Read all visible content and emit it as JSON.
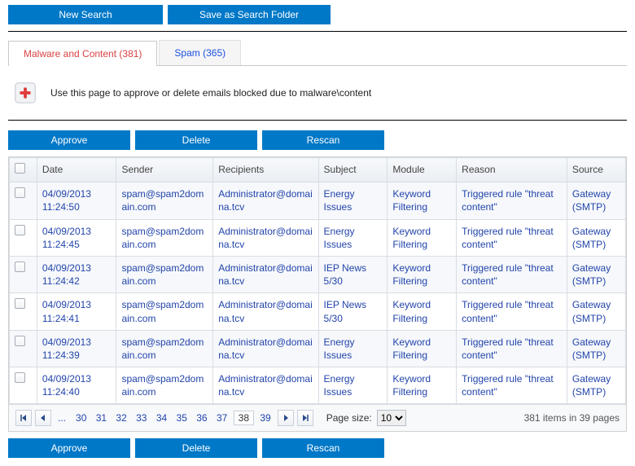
{
  "top_buttons": {
    "new_search": "New Search",
    "save_folder": "Save as Search Folder"
  },
  "tabs": [
    {
      "label": "Malware and Content (381)",
      "active": true
    },
    {
      "label": "Spam (365)",
      "active": false
    }
  ],
  "info_text": "Use this page to approve or delete emails blocked due to malware\\content",
  "actions": {
    "approve": "Approve",
    "delete": "Delete",
    "rescan": "Rescan"
  },
  "columns": {
    "date": "Date",
    "sender": "Sender",
    "recipients": "Recipients",
    "subject": "Subject",
    "module": "Module",
    "reason": "Reason",
    "source": "Source"
  },
  "rows": [
    {
      "date": "04/09/2013 11:24:50",
      "sender": "spam@spam2domain.com",
      "recipients": "Administrator@domaina.tcv",
      "subject": "Energy Issues",
      "module": "Keyword Filtering",
      "reason": "Triggered rule \"threat content\"",
      "source": "Gateway (SMTP)"
    },
    {
      "date": "04/09/2013 11:24:45",
      "sender": "spam@spam2domain.com",
      "recipients": "Administrator@domaina.tcv",
      "subject": "Energy Issues",
      "module": "Keyword Filtering",
      "reason": "Triggered rule \"threat content\"",
      "source": "Gateway (SMTP)"
    },
    {
      "date": "04/09/2013 11:24:42",
      "sender": "spam@spam2domain.com",
      "recipients": "Administrator@domaina.tcv",
      "subject": "IEP News 5/30",
      "module": "Keyword Filtering",
      "reason": "Triggered rule \"threat content\"",
      "source": "Gateway (SMTP)"
    },
    {
      "date": "04/09/2013 11:24:41",
      "sender": "spam@spam2domain.com",
      "recipients": "Administrator@domaina.tcv",
      "subject": "IEP News 5/30",
      "module": "Keyword Filtering",
      "reason": "Triggered rule \"threat content\"",
      "source": "Gateway (SMTP)"
    },
    {
      "date": "04/09/2013 11:24:39",
      "sender": "spam@spam2domain.com",
      "recipients": "Administrator@domaina.tcv",
      "subject": "Energy Issues",
      "module": "Keyword Filtering",
      "reason": "Triggered rule \"threat content\"",
      "source": "Gateway (SMTP)"
    },
    {
      "date": "04/09/2013 11:24:40",
      "sender": "spam@spam2domain.com",
      "recipients": "Administrator@domaina.tcv",
      "subject": "Energy Issues",
      "module": "Keyword Filtering",
      "reason": "Triggered rule \"threat content\"",
      "source": "Gateway (SMTP)"
    }
  ],
  "pager": {
    "ellipsis": "...",
    "pages": [
      "30",
      "31",
      "32",
      "33",
      "34",
      "35",
      "36",
      "37",
      "38",
      "39"
    ],
    "current": "38",
    "page_size_label": "Page size:",
    "page_size_value": "10",
    "totals": "381 items in 39 pages"
  }
}
